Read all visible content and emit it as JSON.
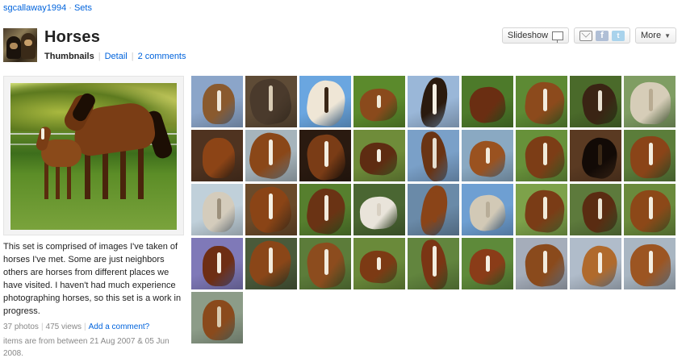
{
  "breadcrumb": {
    "user": "sgcallaway1994",
    "separator": "·",
    "section": "Sets"
  },
  "set": {
    "title": "Horses"
  },
  "subnav": {
    "thumbnails": "Thumbnails",
    "detail": "Detail",
    "comments": "2 comments"
  },
  "toolbar": {
    "slideshow": "Slideshow",
    "more": "More",
    "share_icons": [
      "mail-icon",
      "facebook-icon",
      "twitter-icon"
    ]
  },
  "sidebar": {
    "description": "This set is comprised of images I've taken of horses I've met. Some are just neighbors others are horses from different places we have visited. I haven't had much experience photographing horses, so this set is a work in progress.",
    "photos": "37 photos",
    "views": "475 views",
    "add_comment": "Add a comment?",
    "date_range": "items are from between 21 Aug 2007 & 05 Jun 2008."
  },
  "colors": {
    "link": "#0063dc",
    "title": "#222222",
    "meta": "#888888"
  },
  "thumbnails": [
    {
      "bg": "#8ba5c9",
      "fg": "#8a5a2e",
      "mark": "#f0e8da"
    },
    {
      "bg": "#5e4b36",
      "fg": "#4a3a2c",
      "mark": "#d8cbb4"
    },
    {
      "bg": "#6aa6e0",
      "fg": "#efe6d6",
      "mark": "#3a2616"
    },
    {
      "bg": "#5b8a2c",
      "fg": "#8a4a1c",
      "mark": "#f1ead8"
    },
    {
      "bg": "#9ab7d8",
      "fg": "#2a1a0e",
      "mark": "#f4eee2"
    },
    {
      "bg": "#4d7a2a",
      "fg": "#6a2e12",
      "mark": "#6a2e12"
    },
    {
      "bg": "#5d8a34",
      "fg": "#8c4a1c",
      "mark": "#f2ebde"
    },
    {
      "bg": "#4a6a2a",
      "fg": "#3a2414",
      "mark": "#e9e1d2"
    },
    {
      "bg": "#7f9d63",
      "fg": "#d6cdb8",
      "mark": "#b8ab92"
    },
    {
      "bg": "#4f3320",
      "fg": "#8c4416",
      "mark": "#8c4416"
    },
    {
      "bg": "#a6b4bc",
      "fg": "#8a4718",
      "mark": "#f3ecdf"
    },
    {
      "bg": "#2a1a10",
      "fg": "#7a3c16",
      "mark": "#f3ede0"
    },
    {
      "bg": "#6f8c3a",
      "fg": "#5e2c12",
      "mark": "#f4eee2"
    },
    {
      "bg": "#7aa0c8",
      "fg": "#6a3414",
      "mark": "#e6ded0"
    },
    {
      "bg": "#8aa9c2",
      "fg": "#9a5220",
      "mark": "#f2ebdd"
    },
    {
      "bg": "#67913a",
      "fg": "#7c3d16",
      "mark": "#f1ead9"
    },
    {
      "bg": "#5a3a22",
      "fg": "#120a06",
      "mark": "#3a2816"
    },
    {
      "bg": "#5b7d3a",
      "fg": "#8a4418",
      "mark": "#f3ecdf"
    },
    {
      "bg": "#c0d0da",
      "fg": "#d4ccbc",
      "mark": "#9c907c"
    },
    {
      "bg": "#6a4a2a",
      "fg": "#8a4416",
      "mark": "#f5efe3"
    },
    {
      "bg": "#567f2e",
      "fg": "#6a3314",
      "mark": "#f1eadc"
    },
    {
      "bg": "#4a6632",
      "fg": "#e9e4da",
      "mark": "#d8d0c2"
    },
    {
      "bg": "#6a8aa8",
      "fg": "#8a4418",
      "mark": "#8a4418"
    },
    {
      "bg": "#6e9fd2",
      "fg": "#d2c9b6",
      "mark": "#b8ad98"
    },
    {
      "bg": "#7da24a",
      "fg": "#7a3c16",
      "mark": "#f1ead9"
    },
    {
      "bg": "#5d7a3c",
      "fg": "#5a2c12",
      "mark": "#ece4d4"
    },
    {
      "bg": "#6a8a3c",
      "fg": "#8c4818",
      "mark": "#f2ebdd"
    },
    {
      "bg": "#7f79b8",
      "fg": "#6e2e14",
      "mark": "#f4eee2"
    },
    {
      "bg": "#4a5a3a",
      "fg": "#8a4618",
      "mark": "#f2eadc"
    },
    {
      "bg": "#5c7c3a",
      "fg": "#8c4c1e",
      "mark": "#f2ebdd"
    },
    {
      "bg": "#6a8a3a",
      "fg": "#7c3a14",
      "mark": "#f3ecde"
    },
    {
      "bg": "#62853e",
      "fg": "#7a3514",
      "mark": "#f3ede0"
    },
    {
      "bg": "#5e8a3a",
      "fg": "#8a3c18",
      "mark": "#f4eee2"
    },
    {
      "bg": "#a5adba",
      "fg": "#8a4a1c",
      "mark": "#f2ebdd"
    },
    {
      "bg": "#b0bcca",
      "fg": "#b06a2c",
      "mark": "#f4eee2"
    },
    {
      "bg": "#a9b6c2",
      "fg": "#9c5522",
      "mark": "#f4eee2"
    },
    {
      "bg": "#8c9c88",
      "fg": "#8a4a1c",
      "mark": "#d9cbb0"
    }
  ]
}
